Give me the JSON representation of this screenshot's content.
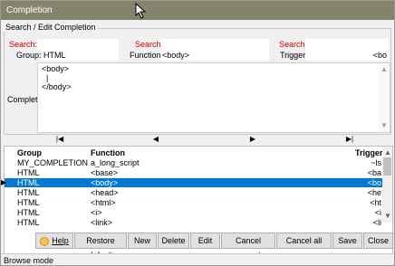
{
  "window": {
    "title": "Completion"
  },
  "groupbox": {
    "legend": "Search / Edit Completion"
  },
  "search": {
    "label_group": "Search:",
    "label_function": "Search:",
    "label_trigger": "Search:",
    "group_label": "Group:",
    "group_value": "HTML",
    "function_label": "Function:",
    "function_value": "<body>",
    "trigger_label": "Trigger:",
    "trigger_value": "<bo"
  },
  "completion": {
    "label": "Complet.:",
    "lines": [
      "<body>",
      "  |",
      "</body>"
    ]
  },
  "navigator": {
    "first": "|◀",
    "prior": "◀",
    "next": "▶",
    "last": "▶|"
  },
  "grid": {
    "columns": [
      "Group",
      "Function",
      "Trigger"
    ],
    "rows": [
      {
        "group": "MY_COMPLETION",
        "function": "a_long_script",
        "trigger": "~ls",
        "selected": false
      },
      {
        "group": "HTML",
        "function": "<base>",
        "trigger": "<ba",
        "selected": false
      },
      {
        "group": "HTML",
        "function": "<body>",
        "trigger": "<bo",
        "selected": true
      },
      {
        "group": "HTML",
        "function": "<head>",
        "trigger": "<he",
        "selected": false
      },
      {
        "group": "HTML",
        "function": "<html>",
        "trigger": "<ht",
        "selected": false
      },
      {
        "group": "HTML",
        "function": "<i>",
        "trigger": "<i",
        "selected": false
      },
      {
        "group": "HTML",
        "function": "<link>",
        "trigger": "<li",
        "selected": false
      }
    ]
  },
  "buttons": {
    "help": "Help",
    "restore_default": "Restore default",
    "new": "New",
    "delete": "Delete",
    "edit": "Edit",
    "cancel_current": "Cancel current",
    "cancel_all": "Cancel all",
    "save": "Save",
    "close": "Close"
  },
  "status": {
    "text": "Browse mode"
  },
  "colors": {
    "titlebar": "#85836c",
    "selection": "#0078d7",
    "search_label": "#d00000"
  }
}
